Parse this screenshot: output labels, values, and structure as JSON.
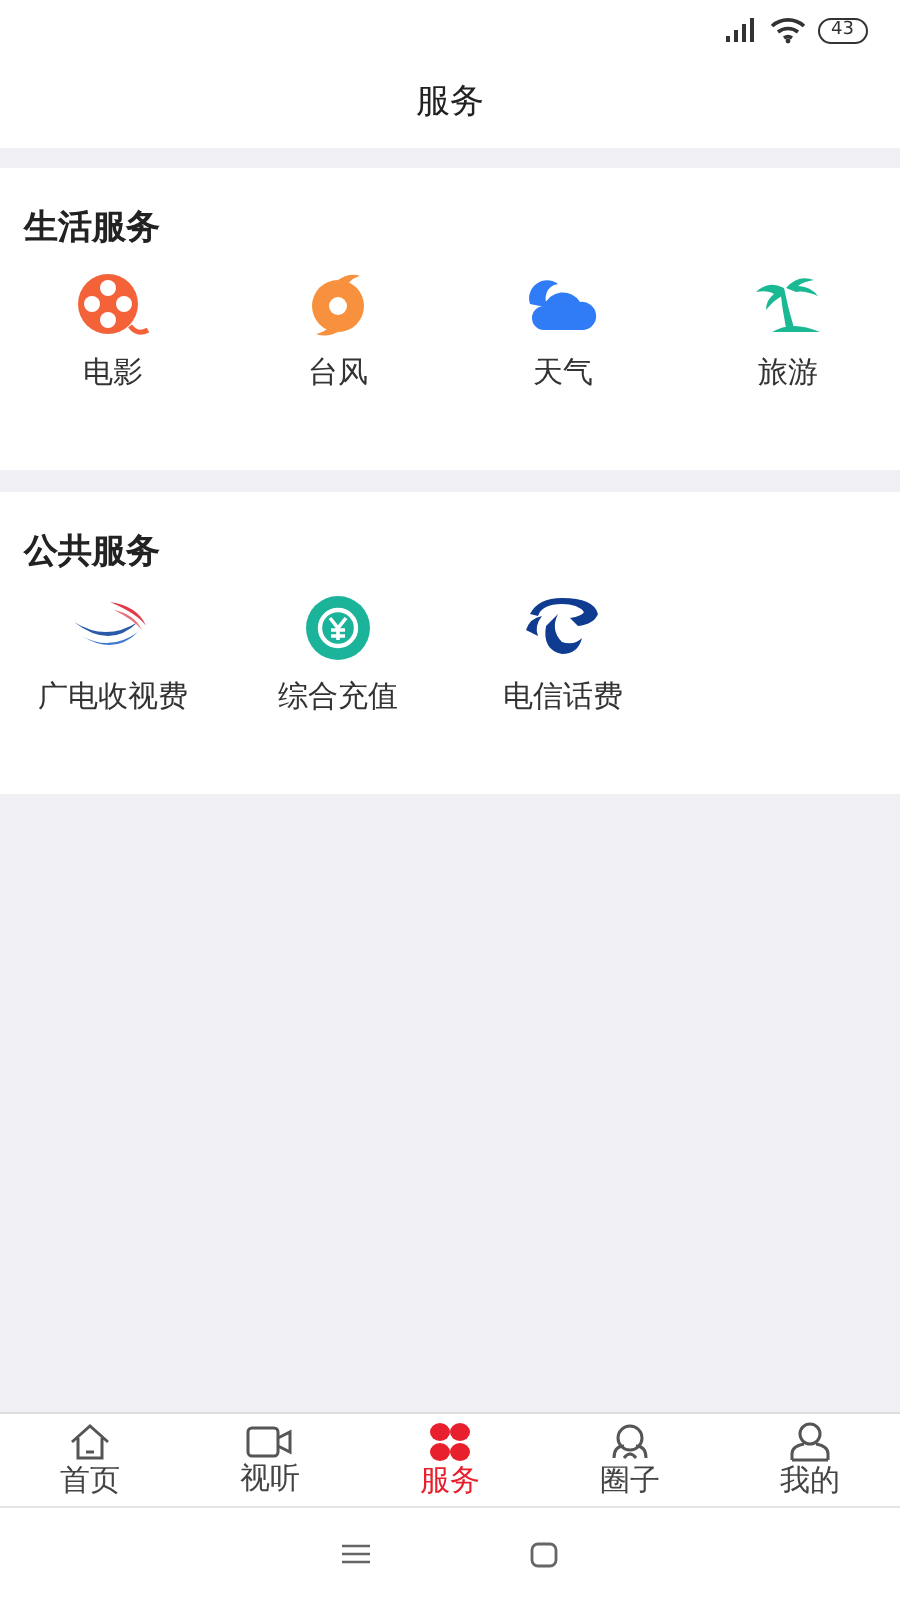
{
  "status_bar": {
    "battery": "43"
  },
  "header": {
    "title": "服务"
  },
  "sections": [
    {
      "title": "生活服务",
      "items": [
        {
          "label": "电影"
        },
        {
          "label": "台风"
        },
        {
          "label": "天气"
        },
        {
          "label": "旅游"
        }
      ]
    },
    {
      "title": "公共服务",
      "items": [
        {
          "label": "广电收视费"
        },
        {
          "label": "综合充值"
        },
        {
          "label": "电信话费"
        }
      ]
    }
  ],
  "bottom_nav": [
    {
      "label": "首页",
      "selected": false
    },
    {
      "label": "视听",
      "selected": false
    },
    {
      "label": "服务",
      "selected": true
    },
    {
      "label": "圈子",
      "selected": false
    },
    {
      "label": "我的",
      "selected": false
    }
  ]
}
